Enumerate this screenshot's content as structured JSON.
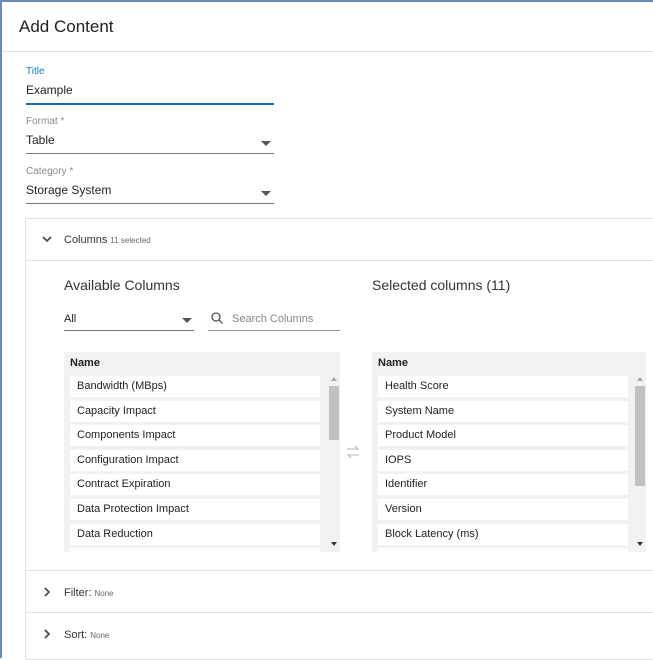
{
  "dialog": {
    "title": "Add Content"
  },
  "form": {
    "title_field": {
      "label": "Title",
      "value": "Example"
    },
    "format_field": {
      "label": "Format *",
      "value": "Table"
    },
    "category_field": {
      "label": "Category *",
      "value": "Storage System"
    }
  },
  "columns_section": {
    "label": "Columns",
    "count_text": "11 selected",
    "available": {
      "title": "Available Columns",
      "filter_value": "All",
      "search_placeholder": "Search Columns",
      "header": "Name",
      "items": [
        "Bandwidth (MBps)",
        "Capacity Impact",
        "Components Impact",
        "Configuration Impact",
        "Contract Expiration",
        "Data Protection Impact",
        "Data Reduction"
      ],
      "scroll_position": 0.0
    },
    "selected": {
      "title": "Selected columns (11)",
      "header": "Name",
      "items": [
        "Health Score",
        "System Name",
        "Product Model",
        "IOPS",
        "Identifier",
        "Version",
        "Block Latency (ms)"
      ],
      "scroll_position": 0.0
    }
  },
  "filter_section": {
    "label": "Filter:",
    "value": "None"
  },
  "sort_section": {
    "label": "Sort:",
    "value": "None"
  },
  "icons": {
    "expanded": "chevron-down-icon",
    "collapsed": "chevron-right-icon",
    "search": "search-icon",
    "swap": "swap-arrows-icon"
  },
  "colors": {
    "accent": "#1976d2",
    "panel_bg": "#f2f2f2",
    "scroll_thumb": "#c1c1c1"
  }
}
